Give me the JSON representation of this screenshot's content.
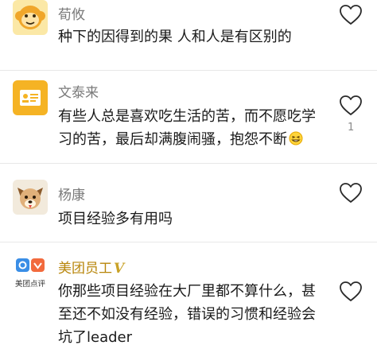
{
  "comments": [
    {
      "username": "荀攸",
      "avatar_icon": "monkey-face-icon",
      "text": "种下的因得到的果 人和人是有区别的",
      "like_count": ""
    },
    {
      "username": "文泰来",
      "avatar_icon": "id-card-icon",
      "text_line1": "有些人总是喜欢吃生活的苦，而不愿吃学",
      "text_line2": "习的苦，最后却满腹闹骚，抱怨不断",
      "trailing_emoji": "grin-emoji-icon",
      "like_count": "1"
    },
    {
      "username": "杨康",
      "avatar_icon": "puppy-face-icon",
      "text": "项目经验多有用吗",
      "like_count": ""
    },
    {
      "username": "美团员工",
      "vip_mark": "V",
      "avatar_icon": "meituan-dianping-logo",
      "avatar_caption": "美团点评",
      "text_line1": "你那些项目经验在大厂里都不算什么，甚",
      "text_line2": "至还不如没有经验，错误的习惯和经验会",
      "text_line3": "坑了leader",
      "like_count": ""
    }
  ],
  "icons": {
    "like": "heart-outline-icon"
  },
  "colors": {
    "accent_gold": "#c9a227",
    "muted": "#7a7a7a",
    "divider": "#e8e8e8"
  }
}
